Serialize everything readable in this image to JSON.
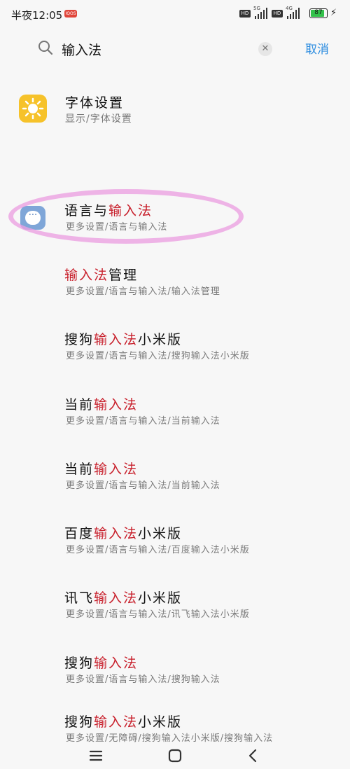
{
  "status_bar": {
    "time": "半夜12:05",
    "notification_badge": "IQOS",
    "hd_1": "HD",
    "net_1": "5G",
    "hd_2": "HD",
    "net_2": "4G",
    "battery": "87"
  },
  "search": {
    "query": "输入法",
    "clear_icon": "close-icon",
    "cancel_label": "取消"
  },
  "top_result": {
    "title": "字体设置",
    "path": "显示/字体设置",
    "icon": "sun-icon",
    "icon_color": "#f6c22a"
  },
  "highlight_color": "#c8202c",
  "results": [
    {
      "prefix": "语言与",
      "hl": "输入法",
      "suffix": "",
      "path": "更多设置/语言与输入法"
    },
    {
      "prefix": "",
      "hl": "输入法",
      "suffix": "管理",
      "path": "更多设置/语言与输入法/输入法管理"
    },
    {
      "prefix": "搜狗",
      "hl": "输入法",
      "suffix": "小米版",
      "path": "更多设置/语言与输入法/搜狗输入法小米版"
    },
    {
      "prefix": "当前",
      "hl": "输入法",
      "suffix": "",
      "path": "更多设置/语言与输入法/当前输入法"
    },
    {
      "prefix": "当前",
      "hl": "输入法",
      "suffix": "",
      "path": "更多设置/语言与输入法/当前输入法"
    },
    {
      "prefix": "百度",
      "hl": "输入法",
      "suffix": "小米版",
      "path": "更多设置/语言与输入法/百度输入法小米版"
    },
    {
      "prefix": "讯飞",
      "hl": "输入法",
      "suffix": "小米版",
      "path": "更多设置/语言与输入法/讯飞输入法小米版"
    },
    {
      "prefix": "搜狗",
      "hl": "输入法",
      "suffix": "",
      "path": "更多设置/语言与输入法/搜狗输入法"
    },
    {
      "prefix": "搜狗",
      "hl": "输入法",
      "suffix": "小米版",
      "path": "更多设置/无障碍/搜狗输入法小米版/搜狗输入法"
    }
  ],
  "navbar": {
    "menu_icon": "menu-icon",
    "home_icon": "home-icon",
    "back_icon": "back-icon"
  }
}
